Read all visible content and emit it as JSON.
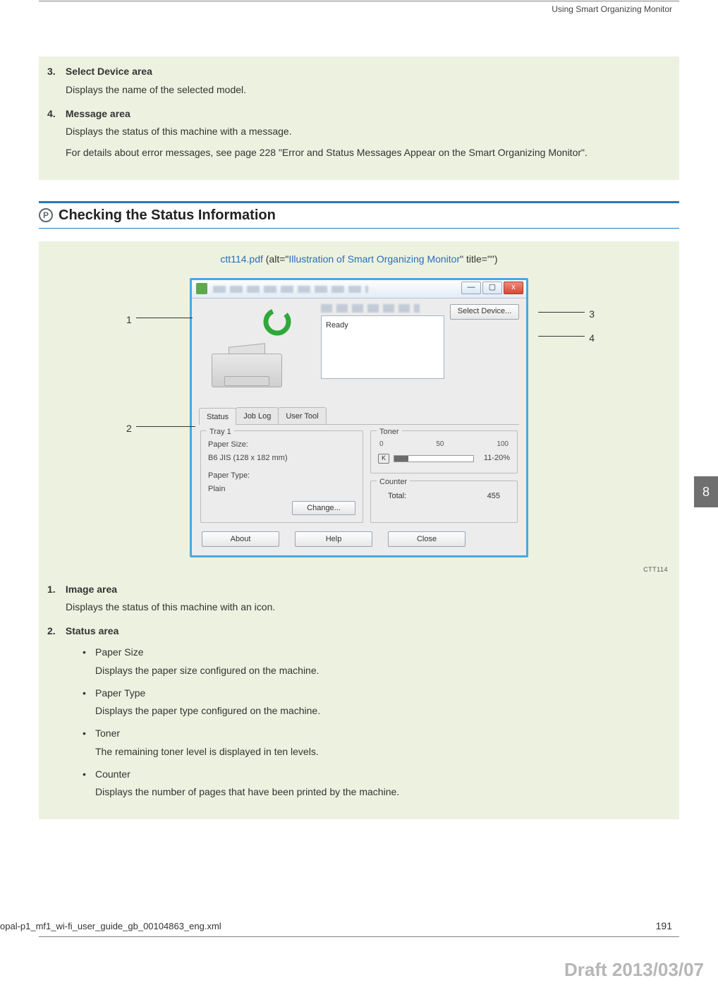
{
  "running_head": "Using Smart Organizing Monitor",
  "list_top": {
    "items": [
      {
        "num": "3.",
        "title": "Select Device area",
        "body": [
          "Displays the name of the selected model."
        ]
      },
      {
        "num": "4.",
        "title": "Message area",
        "body": [
          "Displays the status of this machine with a message.",
          "For details about error messages, see page 228 \"Error and Status Messages Appear on the Smart Organizing Monitor\"."
        ]
      }
    ]
  },
  "heading": {
    "badge": "P",
    "text": "Checking the Status Information"
  },
  "caption": {
    "file": "ctt114.pdf",
    "mid1": " (alt=\"",
    "alt": "Illustration of Smart Organizing Monitor",
    "mid2": "\" title=\"\")"
  },
  "callouts": {
    "c1": "1",
    "c2": "2",
    "c3": "3",
    "c4": "4"
  },
  "screenshot": {
    "win_min": "—",
    "win_max": "▢",
    "win_close": "x",
    "ready": "Ready",
    "select_device": "Select Device...",
    "tabs": {
      "status": "Status",
      "joblog": "Job Log",
      "usertool": "User Tool"
    },
    "tray": {
      "legend": "Tray 1",
      "papersize_label": "Paper Size:",
      "papersize_value": "B6 JIS (128 x 182 mm)",
      "papertype_label": "Paper Type:",
      "papertype_value": "Plain",
      "change": "Change..."
    },
    "toner": {
      "legend": "Toner",
      "scale0": "0",
      "scale50": "50",
      "scale100": "100",
      "icon": "K",
      "pct": "11-20%"
    },
    "counter": {
      "legend": "Counter",
      "total_label": "Total:",
      "total_value": "455"
    },
    "buttons": {
      "about": "About",
      "help": "Help",
      "close": "Close"
    }
  },
  "fig_id": "CTT114",
  "list_bottom": {
    "items": [
      {
        "num": "1.",
        "title": "Image area",
        "body": [
          "Displays the status of this machine with an icon."
        ]
      },
      {
        "num": "2.",
        "title": "Status area",
        "bullets": [
          {
            "title": "Paper Size",
            "body": "Displays the paper size configured on the machine."
          },
          {
            "title": "Paper Type",
            "body": "Displays the paper type configured on the machine."
          },
          {
            "title": "Toner",
            "body": "The remaining toner level is displayed in ten levels."
          },
          {
            "title": "Counter",
            "body": "Displays the number of pages that have been printed by the machine."
          }
        ]
      }
    ]
  },
  "side_tab": "8",
  "footer_file": "opal-p1_mf1_wi-fi_user_guide_gb_00104863_eng.xml",
  "page_num": "191",
  "draft": "Draft 2013/03/07"
}
